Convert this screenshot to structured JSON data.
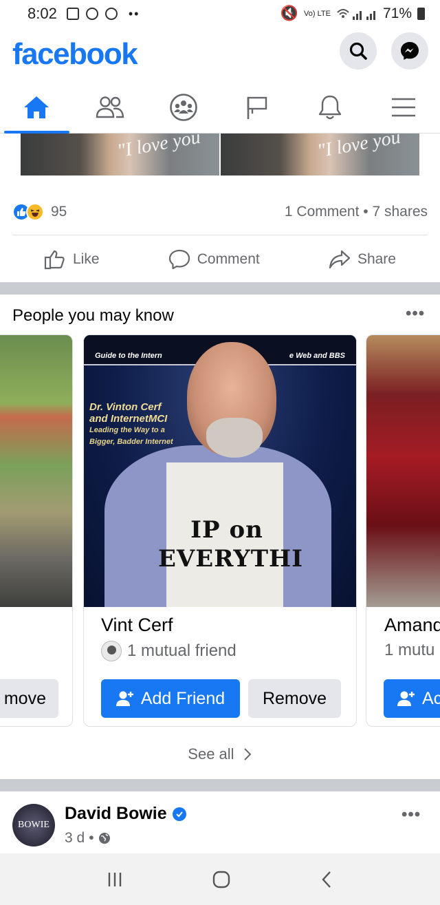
{
  "status_bar": {
    "time": "8:02",
    "network": "Vo) LTE",
    "battery": "71%"
  },
  "header": {
    "logo": "facebook"
  },
  "nav_tabs": [
    {
      "name": "home-icon",
      "active": true
    },
    {
      "name": "friends-icon",
      "active": false
    },
    {
      "name": "groups-icon",
      "active": false
    },
    {
      "name": "pages-flag-icon",
      "active": false
    },
    {
      "name": "notifications-bell-icon",
      "active": false
    },
    {
      "name": "menu-icon",
      "active": false
    }
  ],
  "post": {
    "image_overlay_text_1": "\"I love you",
    "image_overlay_text_2": "\"I love you",
    "reaction_count": "95",
    "stats": "1 Comment • 7 shares",
    "like_label": "Like",
    "comment_label": "Comment",
    "share_label": "Share"
  },
  "pymk": {
    "title": "People you may know",
    "left_card": {
      "remove_label": "move"
    },
    "main_card": {
      "name": "Vint Cerf",
      "mutual": "1 mutual friend",
      "add_label": "Add Friend",
      "remove_label": "Remove",
      "cover_strip_left": "Guide to the Intern",
      "cover_strip_right": "e Web and BBS",
      "cover_line_1": "Dr. Vinton Cerf",
      "cover_line_2": "and InternetMCI",
      "cover_line_3": "Leading the Way to a",
      "cover_line_4": "Bigger, Badder Internet",
      "shirt_line_1": "IP on",
      "shirt_line_2": "EVERYTHI"
    },
    "right_card": {
      "name": "Amand",
      "mutual": "1 mutu",
      "add_label": "Ac"
    },
    "see_all": "See all"
  },
  "next_post": {
    "poster": "David Bowie",
    "avatar_text": "BOWIE",
    "time": "3 d"
  },
  "colors": {
    "brand": "#1877f2",
    "secondary_text": "#65676b",
    "separator": "#c9ccd1"
  }
}
